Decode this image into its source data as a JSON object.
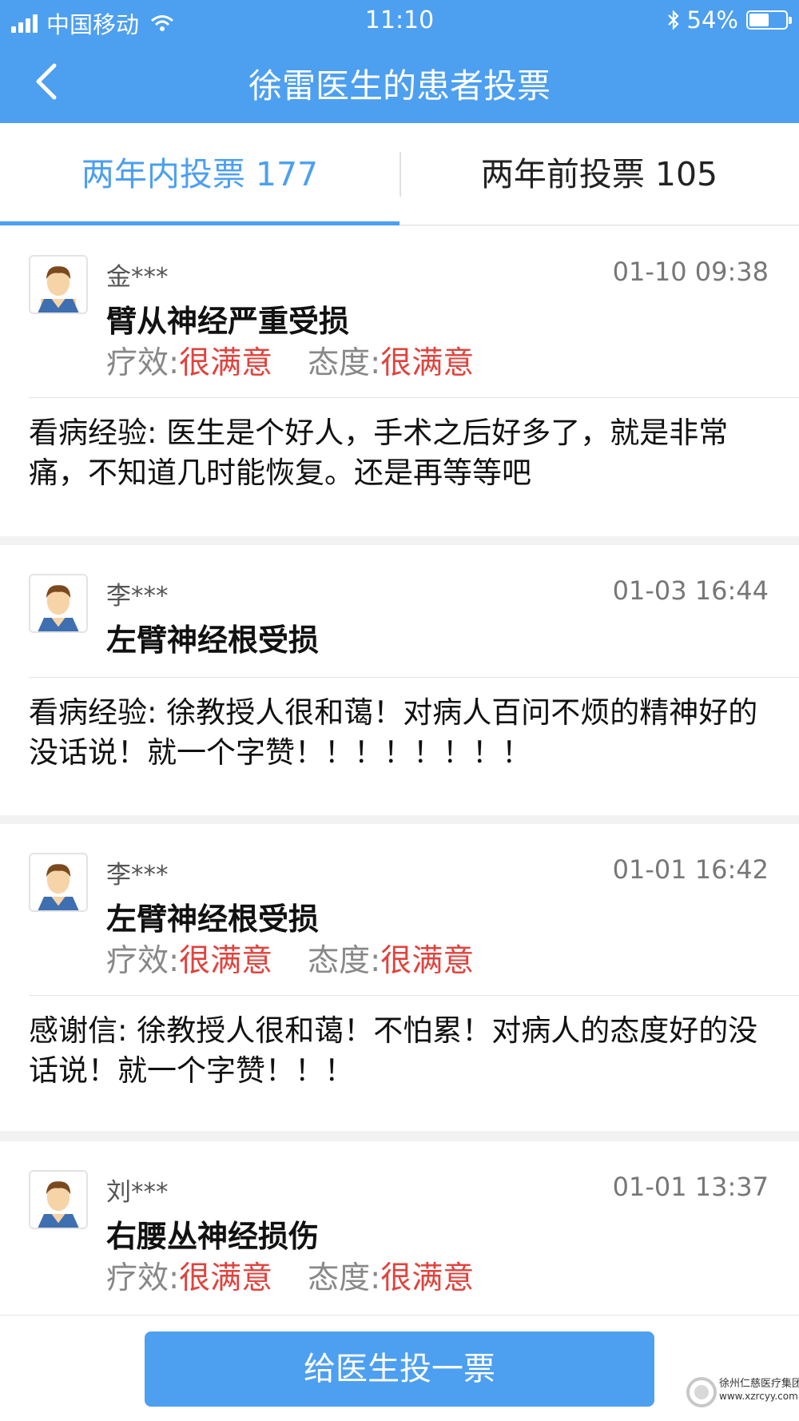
{
  "status_bar": {
    "carrier": "中国移动",
    "time": "11:10",
    "battery": "54%",
    "battery_level": 0.54,
    "icons": [
      "signal-icon",
      "wifi-icon",
      "bluetooth-icon",
      "battery-icon"
    ]
  },
  "nav": {
    "title": "徐雷医生的患者投票",
    "back_icon": "chevron-left-icon"
  },
  "tabs": [
    {
      "label": "两年内投票 177",
      "active": true
    },
    {
      "label": "两年前投票 105",
      "active": false
    }
  ],
  "colors": {
    "accent": "#4d9ff0",
    "rating_value": "#e0433d",
    "background": "#f2f2f2"
  },
  "votes": [
    {
      "user": "金***",
      "time": "01-10 09:38",
      "diagnosis": "臂从神经严重受损",
      "effect_label": "疗效:",
      "effect_value": "很满意",
      "attitude_label": "态度:",
      "attitude_value": "很满意",
      "review": "看病经验: 医生是个好人，手术之后好多了，就是非常痛，不知道几时能恢复。还是再等等吧"
    },
    {
      "user": "李***",
      "time": "01-03 16:44",
      "diagnosis": "左臂神经根受损",
      "review": "看病经验: 徐教授人很和蔼！对病人百问不烦的精神好的没话说！就一个字赞！！！！！！！！"
    },
    {
      "user": "李***",
      "time": "01-01 16:42",
      "diagnosis": "左臂神经根受损",
      "effect_label": "疗效:",
      "effect_value": "很满意",
      "attitude_label": "态度:",
      "attitude_value": "很满意",
      "review": "感谢信: 徐教授人很和蔼！不怕累！对病人的态度好的没话说！就一个字赞！！！"
    },
    {
      "user": "刘***",
      "time": "01-01 13:37",
      "diagnosis": "右腰丛神经损伤",
      "effect_label": "疗效:",
      "effect_value": "很满意",
      "attitude_label": "态度:",
      "attitude_value": "很满意"
    }
  ],
  "bottom": {
    "vote_button": "给医生投一票"
  },
  "watermark": {
    "line1": "徐州仁慈医疗集团",
    "line2": "www.xzrcyy.com"
  }
}
